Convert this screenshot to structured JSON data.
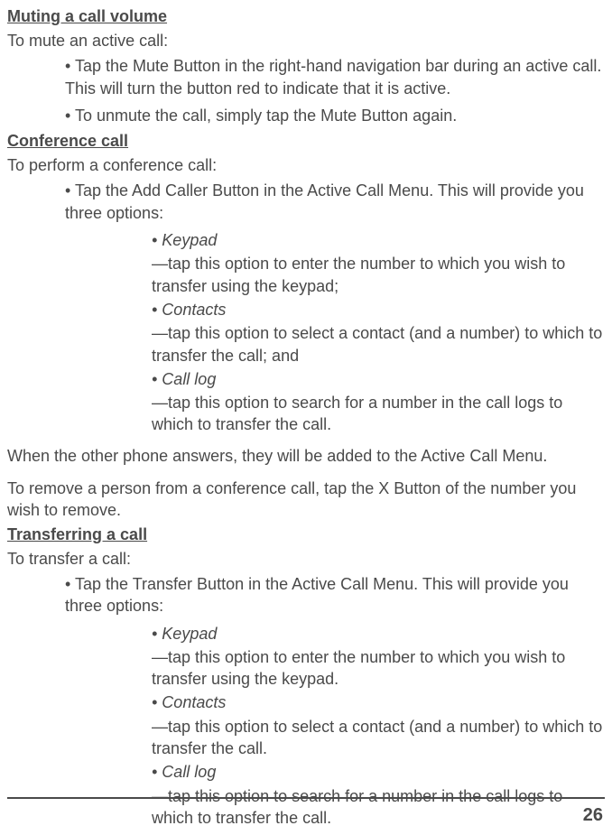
{
  "s1": {
    "heading": "Muting a call volume",
    "intro": "To mute an active call:",
    "b1": "• Tap the Mute Button in the right-hand navigation bar during an active call. This will turn the button red to indicate that it is active.",
    "b2": "• To unmute the call, simply tap the Mute Button again."
  },
  "s2": {
    "heading": "Conference call",
    "intro": "To perform a conference call:",
    "b1": "• Tap the Add Caller Button in the Active Call Menu. This will provide you three options:",
    "sub_keypad_h": "• Keypad",
    "sub_keypad_t": "—tap this option to enter the number to which you wish to transfer using the keypad;",
    "sub_contacts_h": "• Contacts",
    "sub_contacts_t": "—tap this option to select a contact (and a number) to which to transfer the call; and",
    "sub_calllog_h": "• Call log",
    "sub_calllog_t": "—tap this option to search for a number in the call logs to which to transfer the call.",
    "after1": "When the other phone answers, they will be added to the Active Call Menu.",
    "after2": "To remove a person from a conference call, tap the X Button of the number you wish to remove."
  },
  "s3": {
    "heading": "Transferring a call",
    "intro": "To transfer a call:",
    "b1": "• Tap the Transfer Button in the Active Call Menu. This will provide you three options:",
    "sub_keypad_h": "• Keypad",
    "sub_keypad_t": "—tap this option to enter the number to which you wish to transfer using the keypad.",
    "sub_contacts_h": "• Contacts",
    "sub_contacts_t": "—tap this option to select a contact (and a number) to which to transfer the call.",
    "sub_calllog_h": "• Call log",
    "sub_calllog_t": "—tap this option to search for a number in the call logs to which to transfer the call."
  },
  "page_number": "26"
}
